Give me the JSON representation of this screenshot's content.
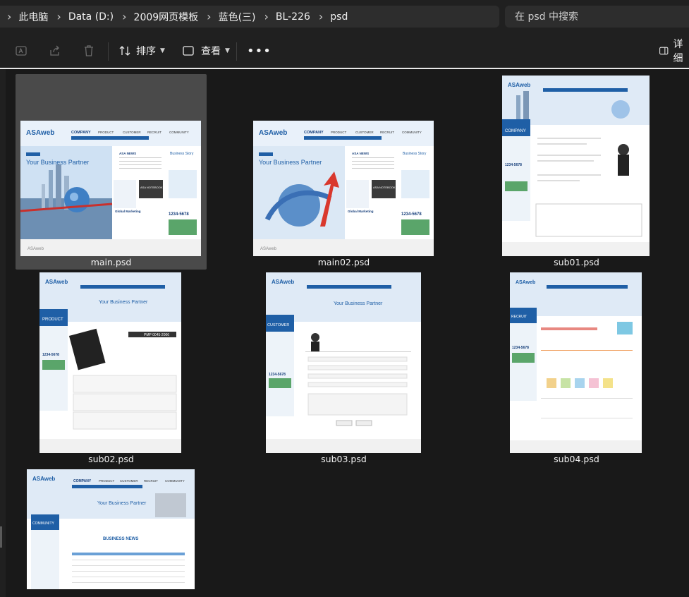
{
  "breadcrumb": [
    "此电脑",
    "Data (D:)",
    "2009网页模板",
    "蓝色(三)",
    "BL-226",
    "psd"
  ],
  "search": {
    "placeholder": "在 psd 中搜索"
  },
  "toolbar": {
    "sort_label": "排序",
    "view_label": "查看",
    "details_label": "详细",
    "icons": {
      "rename": "rename-icon",
      "share": "share-icon",
      "delete": "delete-icon",
      "sort": "sort-icon",
      "view": "view-icon",
      "more": "more-icon",
      "details": "details-pane-icon"
    }
  },
  "files": [
    {
      "name": "main.psd",
      "selected": true
    },
    {
      "name": "main02.psd",
      "selected": false
    },
    {
      "name": "sub01.psd",
      "selected": false
    },
    {
      "name": "sub02.psd",
      "selected": false
    },
    {
      "name": "sub03.psd",
      "selected": false
    },
    {
      "name": "sub04.psd",
      "selected": false
    },
    {
      "name": "",
      "selected": false
    }
  ],
  "thumbnail_text": {
    "brand": "ASAweb",
    "nav": [
      "COMPANY",
      "PRODUCT",
      "CUSTOMER",
      "RECRUIT",
      "COMMUNITY"
    ],
    "slogan": "Your Business Partner",
    "phone": "1234-5678",
    "news": "ASA NEWS",
    "story": "Business Story",
    "notebook": "ASA NOTEBOOK",
    "global": "Global Marketing",
    "section_company": "COMPANY",
    "section_product": "PRODUCT",
    "section_customer": "CUSTOMER",
    "section_recruit": "RECRUIT",
    "section_community": "COMMUNITY",
    "pmp": "PMP 0045-2006",
    "business_news": "BUSINESS NEWS"
  },
  "colors": {
    "accent": "#1f5fa6",
    "navy": "#163e7a",
    "selection": "#4a4a4a",
    "background": "#191919"
  }
}
